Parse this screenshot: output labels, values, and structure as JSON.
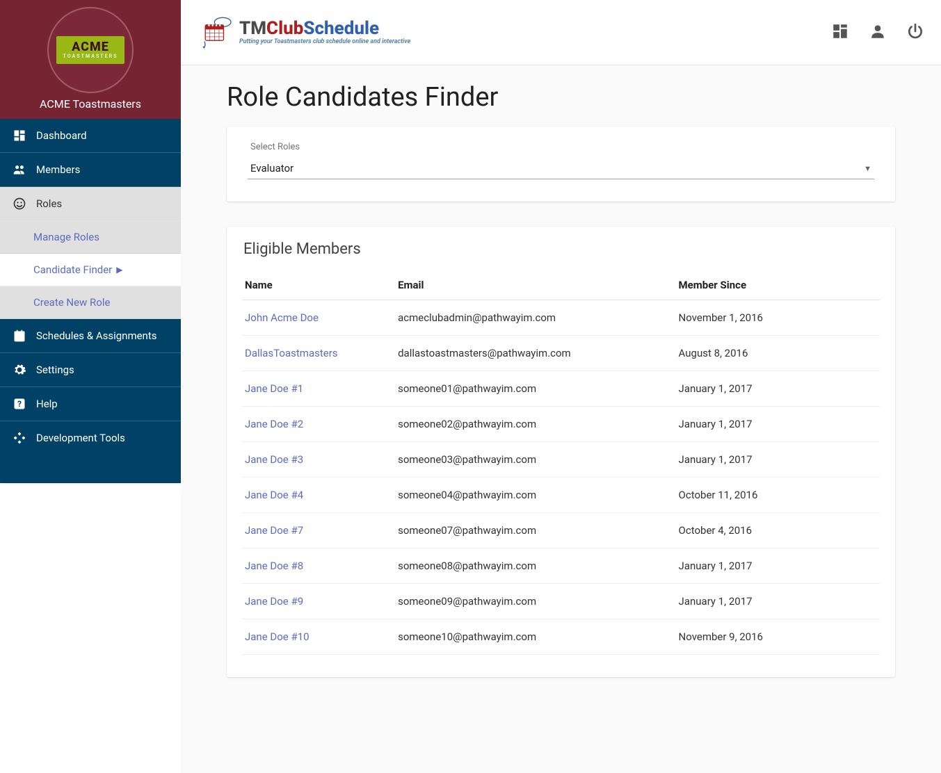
{
  "sidebar": {
    "club_name": "ACME Toastmasters",
    "logo_text_big": "ACME",
    "logo_text_small": "TOASTMASTERS",
    "items": [
      {
        "key": "dashboard",
        "label": "Dashboard",
        "icon": "dashboard-icon"
      },
      {
        "key": "members",
        "label": "Members",
        "icon": "people-icon"
      },
      {
        "key": "roles",
        "label": "Roles",
        "icon": "face-icon",
        "active": true,
        "children": [
          {
            "key": "manage-roles",
            "label": "Manage Roles"
          },
          {
            "key": "candidate-finder",
            "label": "Candidate Finder",
            "active": true
          },
          {
            "key": "create-role",
            "label": "Create New Role"
          }
        ]
      },
      {
        "key": "schedules",
        "label": "Schedules & Assignments",
        "icon": "event-icon"
      },
      {
        "key": "settings",
        "label": "Settings",
        "icon": "gear-icon"
      },
      {
        "key": "help",
        "label": "Help",
        "icon": "help-icon"
      },
      {
        "key": "devtools",
        "label": "Development Tools",
        "icon": "devtools-icon"
      }
    ]
  },
  "topbar": {
    "brand_title_tm": "TM",
    "brand_title_club": "Club",
    "brand_title_schedule": "Schedule",
    "brand_sub": "Putting your Toastmasters club schedule online and interactive",
    "actions": [
      "dashboard",
      "account",
      "power"
    ]
  },
  "page": {
    "title": "Role Candidates Finder",
    "select_label": "Select Roles",
    "select_value": "Evaluator"
  },
  "members_section": {
    "title": "Eligible Members",
    "columns": {
      "name": "Name",
      "email": "Email",
      "member_since": "Member Since"
    },
    "rows": [
      {
        "name": "John Acme Doe",
        "email": "acmeclubadmin@pathwayim.com",
        "member_since": "November 1, 2016"
      },
      {
        "name": "DallasToastmasters",
        "email": "dallastoastmasters@pathwayim.com",
        "member_since": "August 8, 2016"
      },
      {
        "name": "Jane Doe #1",
        "email": "someone01@pathwayim.com",
        "member_since": "January 1, 2017"
      },
      {
        "name": "Jane Doe #2",
        "email": "someone02@pathwayim.com",
        "member_since": "January 1, 2017"
      },
      {
        "name": "Jane Doe #3",
        "email": "someone03@pathwayim.com",
        "member_since": "January 1, 2017"
      },
      {
        "name": "Jane Doe #4",
        "email": "someone04@pathwayim.com",
        "member_since": "October 11, 2016"
      },
      {
        "name": "Jane Doe #7",
        "email": "someone07@pathwayim.com",
        "member_since": "October 4, 2016"
      },
      {
        "name": "Jane Doe #8",
        "email": "someone08@pathwayim.com",
        "member_since": "January 1, 2017"
      },
      {
        "name": "Jane Doe #9",
        "email": "someone09@pathwayim.com",
        "member_since": "January 1, 2017"
      },
      {
        "name": "Jane Doe #10",
        "email": "someone10@pathwayim.com",
        "member_since": "November 9, 2016"
      }
    ]
  },
  "colors": {
    "brand_maroon": "#772432",
    "brand_blue": "#004165",
    "link": "#5C6BC0"
  }
}
